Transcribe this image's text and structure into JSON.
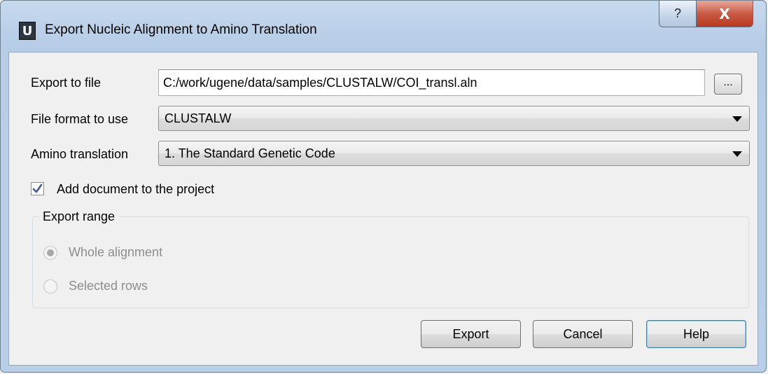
{
  "window": {
    "app_icon_letter": "U",
    "title": "Export Nucleic Alignment to Amino Translation",
    "help_glyph": "?",
    "close_glyph": "X"
  },
  "form": {
    "export_to_file_label": "Export to file",
    "export_to_file_value": "C:/work/ugene/data/samples/CLUSTALW/COI_transl.aln",
    "browse_label": "...",
    "file_format_label": "File format to use",
    "file_format_value": "CLUSTALW",
    "amino_translation_label": "Amino translation",
    "amino_translation_value": "1. The Standard Genetic Code",
    "add_document_label": "Add document to the project",
    "add_document_checked": true
  },
  "export_range": {
    "title": "Export range",
    "options": [
      {
        "label": "Whole alignment",
        "selected": true,
        "enabled": false
      },
      {
        "label": "Selected rows",
        "selected": false,
        "enabled": false
      }
    ]
  },
  "buttons": {
    "export": "Export",
    "cancel": "Cancel",
    "help": "Help"
  },
  "colors": {
    "title_bar": "#b9cfe7",
    "close_button": "#c95a44",
    "default_button_border": "#3c7fb1",
    "check_mark": "#3d5aa6"
  }
}
